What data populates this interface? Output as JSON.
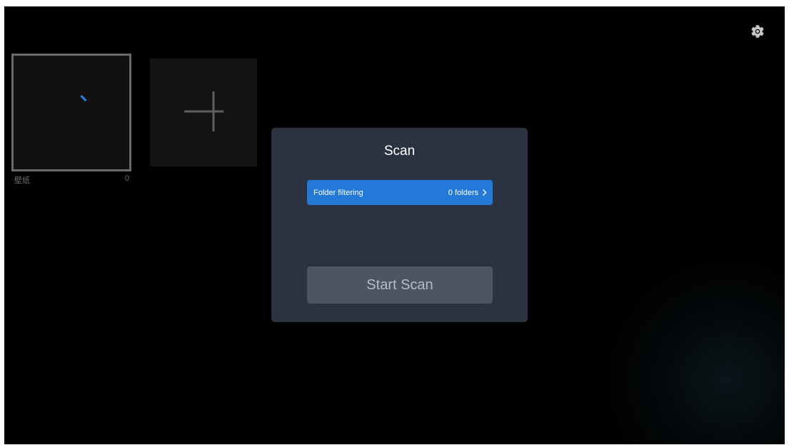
{
  "albums": [
    {
      "label": "壁纸",
      "count": "0"
    }
  ],
  "add_tile": {
    "icon": "plus-icon"
  },
  "settings": {
    "icon": "gear-icon"
  },
  "dialog": {
    "title": "Scan",
    "folder_filter": {
      "label": "Folder filtering",
      "value": "0 folders",
      "icon": "chevron-right-icon"
    },
    "start_button": "Start Scan"
  },
  "colors": {
    "background": "#000000",
    "dialog_bg": "#2b3343",
    "accent": "#2479d8",
    "button_disabled": "#4b5563"
  }
}
